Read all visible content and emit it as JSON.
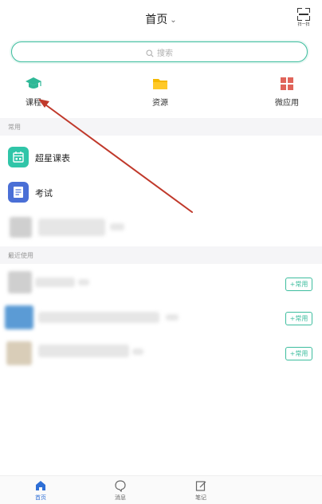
{
  "header": {
    "title": "首页",
    "scan_label": "扫一扫"
  },
  "search": {
    "placeholder": "搜索"
  },
  "quick_actions": [
    {
      "label": "课程",
      "icon": "graduation-cap-icon"
    },
    {
      "label": "资源",
      "icon": "folder-icon"
    },
    {
      "label": "微应用",
      "icon": "apps-grid-icon"
    }
  ],
  "section_common": {
    "label": "常用"
  },
  "common_apps": [
    {
      "label": "超星课表",
      "icon": "timetable-icon"
    },
    {
      "label": "考试",
      "icon": "exam-icon"
    }
  ],
  "section_recent": {
    "label": "最近使用"
  },
  "recent_items": [
    {
      "join_label": "+常用"
    },
    {
      "join_label": "+常用"
    },
    {
      "join_label": "+常用"
    }
  ],
  "tabbar": {
    "items": [
      {
        "label": "首页",
        "icon": "home-icon",
        "active": true
      },
      {
        "label": "消息",
        "icon": "chat-bubble-icon",
        "active": false
      },
      {
        "label": "笔记",
        "icon": "note-edit-icon",
        "active": false
      }
    ]
  },
  "colors": {
    "accent_green": "#3dbd9e",
    "folder_yellow": "#f5b800",
    "apps_red": "#e0645a",
    "timetable_teal": "#30c5a8",
    "exam_blue": "#4a6fd6",
    "active_tab_blue": "#2f6fd6",
    "annotation_red": "#c0392b"
  }
}
